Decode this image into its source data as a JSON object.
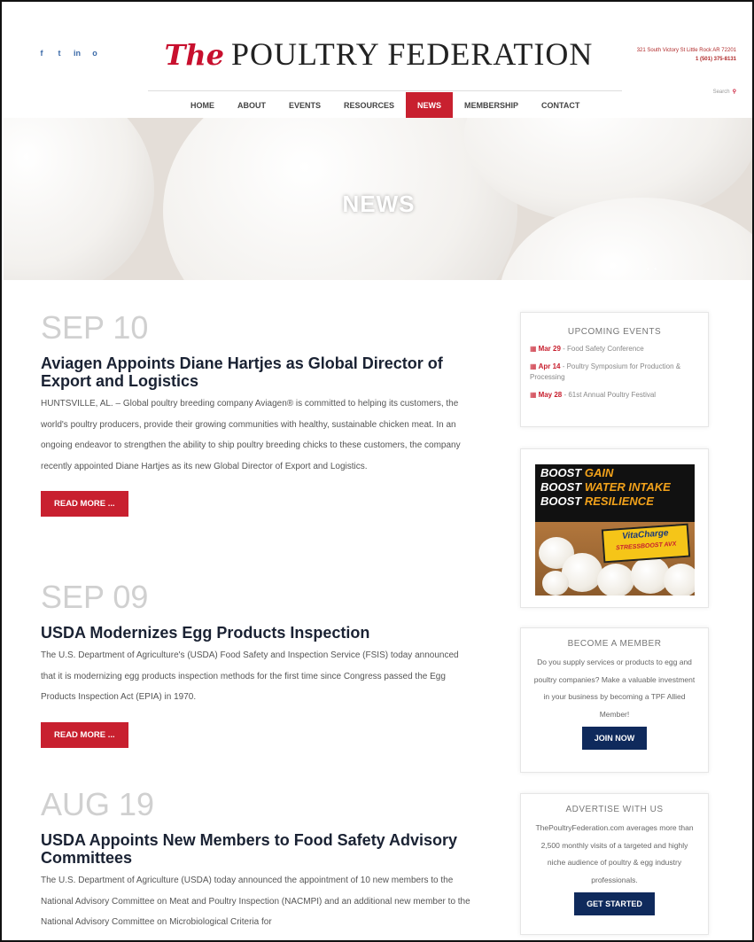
{
  "social": [
    "f",
    "t",
    "in",
    "o"
  ],
  "logo": {
    "the": "The",
    "name": "POULTRY FEDERATION"
  },
  "contact": {
    "address": "321 South Victory St Little Rock AR 72201",
    "phone": "1 (501) 375-8131"
  },
  "search": {
    "label": "Search"
  },
  "nav": [
    "HOME",
    "ABOUT",
    "EVENTS",
    "RESOURCES",
    "NEWS",
    "MEMBERSHIP",
    "CONTACT"
  ],
  "nav_active": "NEWS",
  "hero": {
    "title": "NEWS"
  },
  "articles": [
    {
      "date": "SEP 10",
      "title": "Aviagen Appoints Diane Hartjes as Global Director of Export and Logistics",
      "excerpt": "HUNTSVILLE, AL. – Global poultry breeding company Aviagen® is committed to helping its customers, the world's poultry producers, provide their growing communities with healthy, sustainable chicken meat. In an ongoing endeavor to strengthen the ability to ship poultry breeding chicks to these customers, the company recently appointed Diane Hartjes as its new Global Director of Export and Logistics.",
      "button": "READ MORE ..."
    },
    {
      "date": "SEP 09",
      "title": "USDA Modernizes Egg Products Inspection",
      "excerpt": "The U.S. Department of Agriculture's (USDA) Food Safety and Inspection Service (FSIS) today announced that it is modernizing egg products inspection methods for the first time since Congress passed the Egg Products Inspection Act (EPIA) in 1970.",
      "button": "READ MORE ..."
    },
    {
      "date": "AUG 19",
      "title": "USDA Appoints New Members to Food Safety Advisory Committees",
      "excerpt": "The U.S. Department of Agriculture (USDA) today announced the appointment of 10 new members to the National Advisory Committee on Meat and Poultry Inspection (NACMPI) and an additional new member to the National Advisory Committee on Microbiological Criteria for"
    }
  ],
  "sidebar": {
    "events": {
      "title": "UPCOMING EVENTS",
      "items": [
        {
          "date": "Mar 29",
          "text": " - Food Safety Conference"
        },
        {
          "date": "Apr 14",
          "text": " - Poultry Symposium for Production & Processing"
        },
        {
          "date": "May 28",
          "text": " - 61st Annual Poultry Festival"
        }
      ]
    },
    "ad": {
      "lines": [
        {
          "a": "BOOST",
          "b": " GAIN"
        },
        {
          "a": "BOOST",
          "b": " WATER INTAKE"
        },
        {
          "a": "BOOST",
          "b": " RESILIENCE"
        }
      ],
      "product": "VitaCharge",
      "product_sub": "STRESSBOOST AVX"
    },
    "member": {
      "title": "BECOME A MEMBER",
      "text": "Do you supply services or products to egg and poultry companies? Make a valuable investment in your business by becoming a TPF Allied Member!",
      "button": "JOIN NOW"
    },
    "advertise": {
      "title": "ADVERTISE WITH US",
      "text": "ThePoultryFederation.com averages more than 2,500 monthly visits of a targeted and highly niche audience of poultry & egg industry professionals.",
      "button": "GET STARTED"
    }
  },
  "colors": {
    "accent": "#c8202f",
    "navy": "#0f2a5c",
    "date_gray": "#d0d0d0",
    "title": "#1a2233"
  }
}
